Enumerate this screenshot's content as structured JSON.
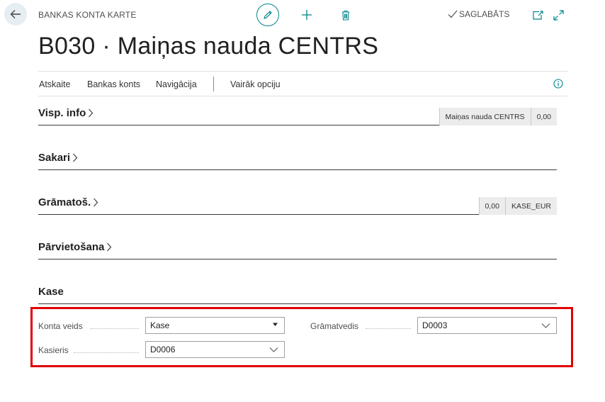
{
  "header": {
    "page_caption": "BANKAS KONTA KARTE",
    "saved_label": "SAGLABĀTS",
    "title": "B030 · Maiņas nauda CENTRS"
  },
  "icons": {
    "back": "arrow-left-icon",
    "edit": "pencil-icon",
    "new": "plus-icon",
    "delete": "trash-icon",
    "saved": "checkmark-icon",
    "open_new_window": "open-new-window-icon",
    "expand": "expand-icon",
    "info": "info-icon",
    "section_chevron": "chevron-right-icon",
    "dropdown": "chevron-down-icon",
    "dropdown_solid": "triangle-down-icon"
  },
  "actionbar": {
    "items": [
      "Atskaite",
      "Bankas konts",
      "Navigācija"
    ],
    "more_options": "Vairāk opciju"
  },
  "sections": {
    "visp_info": {
      "title": "Visp. info",
      "summary": [
        "Maiņas nauda CENTRS",
        "0,00"
      ]
    },
    "sakari": {
      "title": "Sakari"
    },
    "gramatos": {
      "title": "Grāmatoš.",
      "summary": [
        "0,00",
        "KASE_EUR"
      ]
    },
    "parvietosana": {
      "title": "Pārvietošana"
    },
    "kase": {
      "title": "Kase",
      "fields": {
        "konta_veids": {
          "label": "Konta veids",
          "value": "Kase"
        },
        "kasieris": {
          "label": "Kasieris",
          "value": "D0006"
        },
        "gramatvedis": {
          "label": "Grāmatvedis",
          "value": "D0003"
        }
      }
    }
  },
  "colors": {
    "accent": "#008489",
    "highlight_border": "#e00000",
    "summary_bg": "#ececec"
  }
}
